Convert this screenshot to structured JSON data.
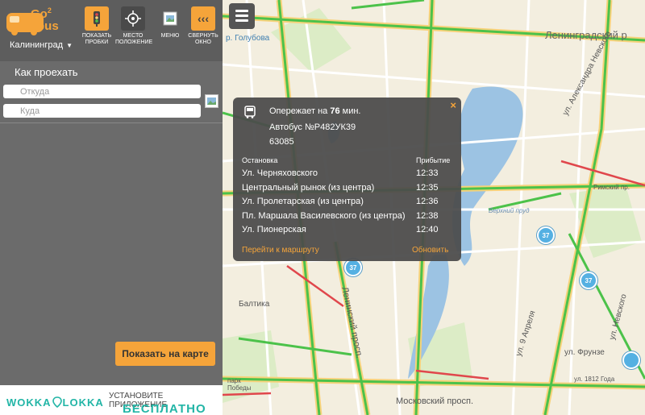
{
  "app": {
    "logo_text_top": "Go",
    "logo_text_num": "2",
    "logo_text_bottom": "bus",
    "city": "Калининград"
  },
  "toolbar": {
    "traffic_label": "ПОКАЗАТЬ ПРОБКИ",
    "location_label": "МЕСТО ПОЛОЖЕНИЕ",
    "menu_label": "МЕНЮ",
    "collapse_label": "СВЕРНУТЬ ОКНО",
    "collapse_glyph": "‹‹‹"
  },
  "route_panel": {
    "title": "Как проехать",
    "from_placeholder": "Откуда",
    "to_placeholder": "Куда",
    "show_on_map": "Показать на карте"
  },
  "banner": {
    "brand": "WOKKA LOKKA",
    "install": "УСТАНОВИТЕ ПРИЛОЖЕНИЕ",
    "free": "БЕСПЛАТНО"
  },
  "map": {
    "labels": {
      "leningradsky": "Ленинградский р",
      "golubova": "р. Голубова",
      "upper_pond": "Верхний пруд",
      "alexander_nevsky": "ул. Александра Невского",
      "leninsky": "Ленинский просп.",
      "baltika": "Балтика",
      "ul_9_aprelya": "ул. 9 Апреля",
      "frunze": "ул. Фрунзе",
      "moskovsky": "Московский просп.",
      "ul_1812": "ул. 1812 Года",
      "park": "парк Победы",
      "rimsky": "Римский пр.",
      "nevskogo": "ул. Невского"
    },
    "bus_markers": [
      "37",
      "37",
      "37"
    ]
  },
  "popup": {
    "close": "×",
    "ahead_prefix": "Опережает на",
    "ahead_value": "76",
    "ahead_suffix": "мин.",
    "bus": "Автобус №Р482УК39",
    "code": "63085",
    "col_stop": "Остановка",
    "col_arrival": "Прибытие",
    "stops": [
      {
        "name": "Ул. Черняховского",
        "time": "12:33"
      },
      {
        "name": "Центральный рынок (из центра)",
        "time": "12:35"
      },
      {
        "name": "Ул. Пролетарская (из центра)",
        "time": "12:36"
      },
      {
        "name": "Пл. Маршала Василевского (из центра)",
        "time": "12:38"
      },
      {
        "name": "Ул. Пионерская",
        "time": "12:40"
      }
    ],
    "go_to_route": "Перейти к маршруту",
    "refresh": "Обновить"
  },
  "colors": {
    "accent": "#f5a43a",
    "panel": "#6b6b6b",
    "traffic_green": "#4cc24a",
    "traffic_red": "#e0474c",
    "major_road": "#f6d27a",
    "water": "#9cc3e3"
  }
}
